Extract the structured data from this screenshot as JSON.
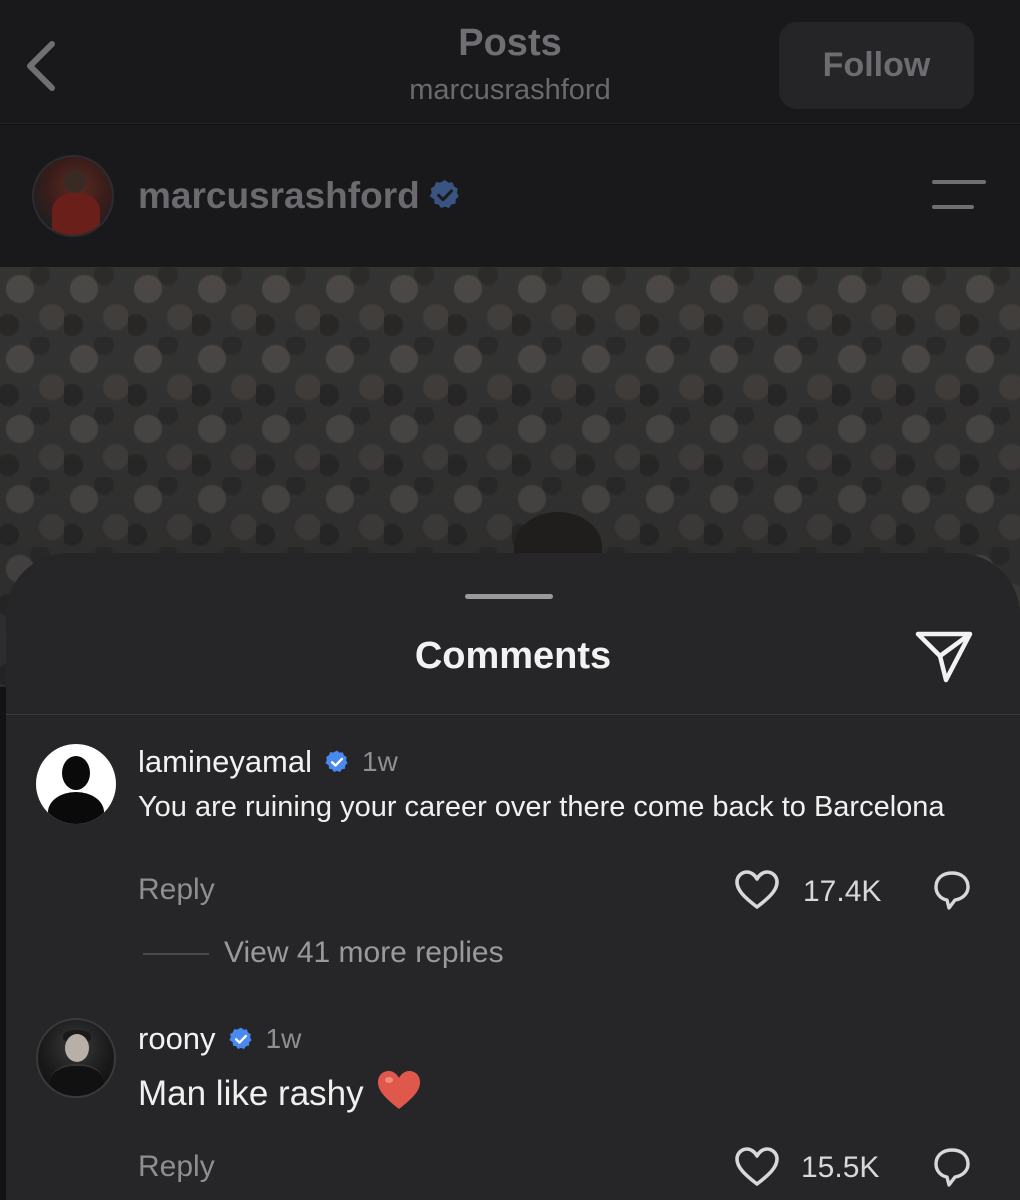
{
  "header": {
    "title": "Posts",
    "subtitle": "marcusrashford",
    "follow_label": "Follow"
  },
  "post": {
    "username": "marcusrashford",
    "verified": true
  },
  "comments_sheet": {
    "title": "Comments",
    "comments": [
      {
        "username": "lamineyamal",
        "verified": true,
        "time": "1w",
        "text": "You are ruining your career over there come back to Barcelona",
        "reply_label": "Reply",
        "likes": "17.4K",
        "view_replies": "View 41 more replies"
      },
      {
        "username": "roony",
        "verified": true,
        "time": "1w",
        "text": "Man like rashy",
        "emoji": "heart",
        "reply_label": "Reply",
        "likes": "15.5K"
      }
    ]
  },
  "colors": {
    "verified_blue": "#4a8af0",
    "sheet_background": "#262628",
    "heart_emoji": "#e0574c"
  },
  "icons": [
    "back-chevron-icon",
    "menu-icon",
    "verified-badge-icon",
    "share-icon",
    "heart-icon",
    "reply-bubble-icon"
  ]
}
